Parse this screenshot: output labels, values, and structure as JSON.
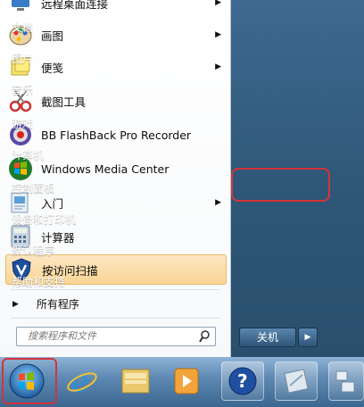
{
  "programs": [
    {
      "label": "远程桌面连接",
      "icon": "remote-desktop-icon",
      "has_arrow": true
    },
    {
      "label": "画图",
      "icon": "paint-icon",
      "has_arrow": true
    },
    {
      "label": "便笺",
      "icon": "sticky-notes-icon",
      "has_arrow": true
    },
    {
      "label": "截图工具",
      "icon": "snipping-tool-icon",
      "has_arrow": false
    },
    {
      "label": "BB FlashBack Pro Recorder",
      "icon": "flashback-recorder-icon",
      "has_arrow": false
    },
    {
      "label": "Windows Media Center",
      "icon": "media-center-icon",
      "has_arrow": false
    },
    {
      "label": "入门",
      "icon": "getting-started-icon",
      "has_arrow": true
    },
    {
      "label": "计算器",
      "icon": "calculator-icon",
      "has_arrow": false
    },
    {
      "label": "按访问扫描",
      "icon": "antivirus-scan-icon",
      "has_arrow": false
    }
  ],
  "all_programs_label": "所有程序",
  "search": {
    "placeholder": "搜索程序和文件",
    "icon": "search-icon"
  },
  "right_items": [
    "文档",
    "图片",
    "音乐",
    "游戏",
    "计算机",
    "控制面板",
    "设备和打印机",
    "默认程序",
    "帮助和支持"
  ],
  "shutdown_label": "关机",
  "taskbar": [
    "start-orb-icon",
    "internet-explorer-icon",
    "file-explorer-icon",
    "media-player-icon",
    "help-icon",
    "tablet-icon",
    "network-icon"
  ],
  "colors": {
    "highlight_border": "#d4343b",
    "selected_item": "#f9d595",
    "right_panel": "#2e5676"
  }
}
